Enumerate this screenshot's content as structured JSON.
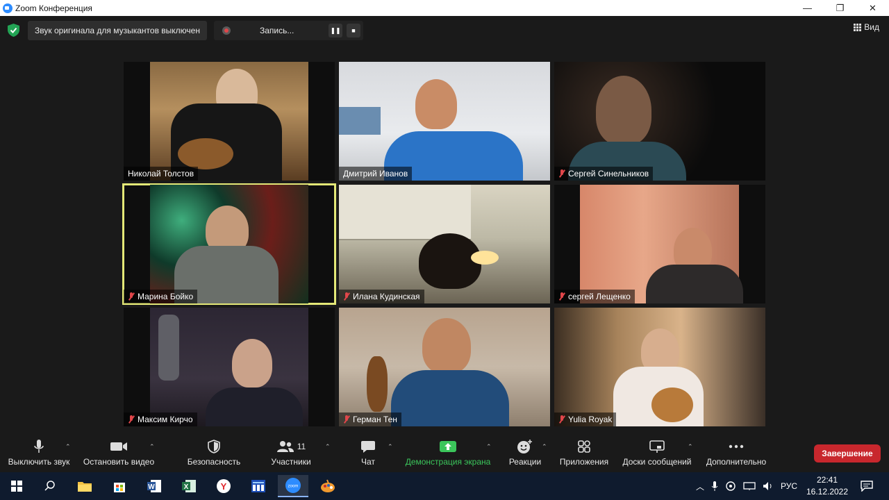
{
  "window": {
    "title": "Zoom Конференция",
    "controls": [
      "—",
      "❐",
      "✕"
    ]
  },
  "topbar": {
    "original_sound": "Звук оригинала для музыкантов выключен",
    "recording": "Запись...",
    "view": "Вид"
  },
  "participants": [
    {
      "name": "Николай Толстов",
      "muted": false
    },
    {
      "name": "Дмитрий Иванов",
      "muted": false
    },
    {
      "name": "Сергей Синельников",
      "muted": true
    },
    {
      "name": "Марина Бойко",
      "muted": true,
      "active_speaker": true
    },
    {
      "name": "Илана Кудинская",
      "muted": true
    },
    {
      "name": "сергей Лещенко",
      "muted": true
    },
    {
      "name": "Максим Кирчо",
      "muted": true
    },
    {
      "name": "Герман Тен",
      "muted": true
    },
    {
      "name": "Yulia Royak",
      "muted": true
    }
  ],
  "toolbar": {
    "mute": "Выключить звук",
    "video": "Остановить видео",
    "security": "Безопасность",
    "participants": "Участники",
    "participants_count": "11",
    "chat": "Чат",
    "share": "Демонстрация экрана",
    "reactions": "Реакции",
    "apps": "Приложения",
    "whiteboards": "Доски сообщений",
    "more": "Дополнительно",
    "end": "Завершение"
  },
  "colors": {
    "share_green": "#3bc65b",
    "end_red": "#c8272d",
    "active_border": "#e4e877",
    "muted_red": "#e0464a"
  },
  "taskbar": {
    "language": "РУС",
    "time": "22:41",
    "date": "16.12.2022",
    "zoom_label": "zoom"
  }
}
